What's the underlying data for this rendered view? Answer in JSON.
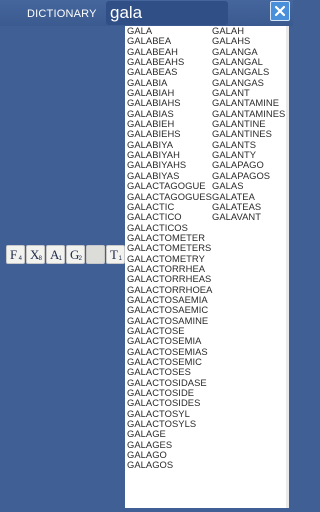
{
  "header": {
    "label": "DICTIONARY",
    "search_value": "gala",
    "close_icon": "close-x-icon",
    "accent": "#4a8fd9"
  },
  "tiles": [
    {
      "letter": "F",
      "score": "4"
    },
    {
      "letter": "X",
      "score": "8"
    },
    {
      "letter": "A",
      "score": "1"
    },
    {
      "letter": "G",
      "score": "2"
    },
    {
      "letter": "",
      "score": ""
    },
    {
      "letter": "T",
      "score": "1"
    }
  ],
  "results": {
    "column1": [
      "GALA",
      "GALABEA",
      "GALABEAH",
      "GALABEAHS",
      "GALABEAS",
      "GALABIA",
      "GALABIAH",
      "GALABIAHS",
      "GALABIAS",
      "GALABIEH",
      "GALABIEHS",
      "GALABIYA",
      "GALABIYAH",
      "GALABIYAHS",
      "GALABIYAS",
      "GALACTAGOGUE",
      "GALACTAGOGUES",
      "GALACTIC",
      "GALACTICO",
      "GALACTICOS",
      "GALACTOMETER",
      "GALACTOMETERS",
      "GALACTOMETRY",
      "GALACTORRHEA",
      "GALACTORRHEAS",
      "GALACTORRHOEA",
      "GALACTOSAEMIA",
      "GALACTOSAEMIC",
      "GALACTOSAMINE",
      "GALACTOSE",
      "GALACTOSEMIA",
      "GALACTOSEMIAS",
      "GALACTOSEMIC",
      "GALACTOSES",
      "GALACTOSIDASE",
      "GALACTOSIDE",
      "GALACTOSIDES",
      "GALACTOSYL",
      "GALACTOSYLS",
      "GALAGE",
      "GALAGES",
      "GALAGO",
      "GALAGOS"
    ],
    "column2": [
      "GALAH",
      "GALAHS",
      "GALANGA",
      "GALANGAL",
      "GALANGALS",
      "GALANGAS",
      "GALANT",
      "GALANTAMINE",
      "GALANTAMINES",
      "GALANTINE",
      "GALANTINES",
      "GALANTS",
      "GALANTY",
      "GALAPAGO",
      "GALAPAGOS",
      "GALAS",
      "GALATEA",
      "GALATEAS",
      "GALAVANT"
    ]
  }
}
